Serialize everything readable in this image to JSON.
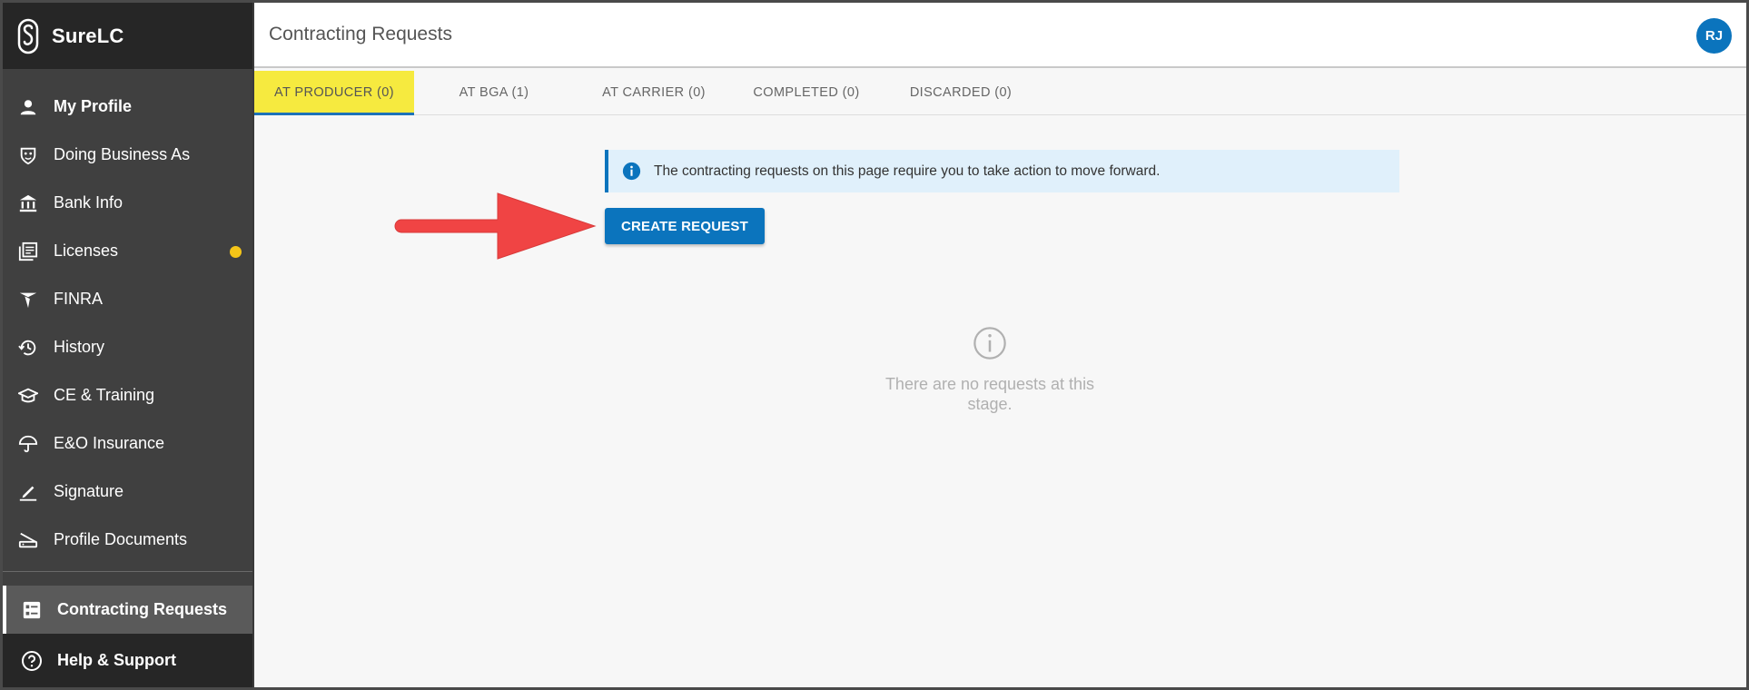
{
  "app": {
    "name": "SureLC",
    "logo_icon": "surelc-logo-icon"
  },
  "sidebar": {
    "items": [
      {
        "label": "My Profile",
        "icon": "person-icon",
        "bold": true
      },
      {
        "label": "Doing Business As",
        "icon": "mask-icon"
      },
      {
        "label": "Bank Info",
        "icon": "bank-icon"
      },
      {
        "label": "Licenses",
        "icon": "documents-icon",
        "has_indicator": true,
        "indicator_color": "#f5c518"
      },
      {
        "label": "FINRA",
        "icon": "finra-icon"
      },
      {
        "label": "History",
        "icon": "history-icon"
      },
      {
        "label": "CE & Training",
        "icon": "graduation-cap-icon"
      },
      {
        "label": "E&O Insurance",
        "icon": "umbrella-icon"
      },
      {
        "label": "Signature",
        "icon": "pen-icon"
      },
      {
        "label": "Profile Documents",
        "icon": "scanner-icon"
      }
    ],
    "active_item": {
      "label": "Contracting Requests",
      "icon": "list-icon"
    },
    "help_item": {
      "label": "Help & Support",
      "icon": "help-circle-icon"
    }
  },
  "header": {
    "title": "Contracting Requests",
    "avatar_initials": "RJ"
  },
  "tabs": [
    {
      "label": "AT PRODUCER (0)",
      "active": true
    },
    {
      "label": "AT BGA (1)"
    },
    {
      "label": "AT CARRIER (0)"
    },
    {
      "label": "COMPLETED (0)"
    },
    {
      "label": "DISCARDED (0)"
    }
  ],
  "info_banner": {
    "text": "The contracting requests on this page require you to take action to move forward.",
    "icon": "info-icon"
  },
  "create_button": {
    "label": "CREATE REQUEST"
  },
  "annotation": {
    "icon": "red-arrow-icon"
  },
  "empty_state": {
    "icon": "info-outline-icon",
    "text": "There are no requests at this stage."
  },
  "colors": {
    "sidebar_bg": "#404040",
    "sidebar_dark": "#262626",
    "accent_blue": "#0b74bd",
    "active_tab_highlight": "#f6ea3f",
    "banner_bg": "#e0f0fb",
    "arrow_red": "#f04444"
  }
}
